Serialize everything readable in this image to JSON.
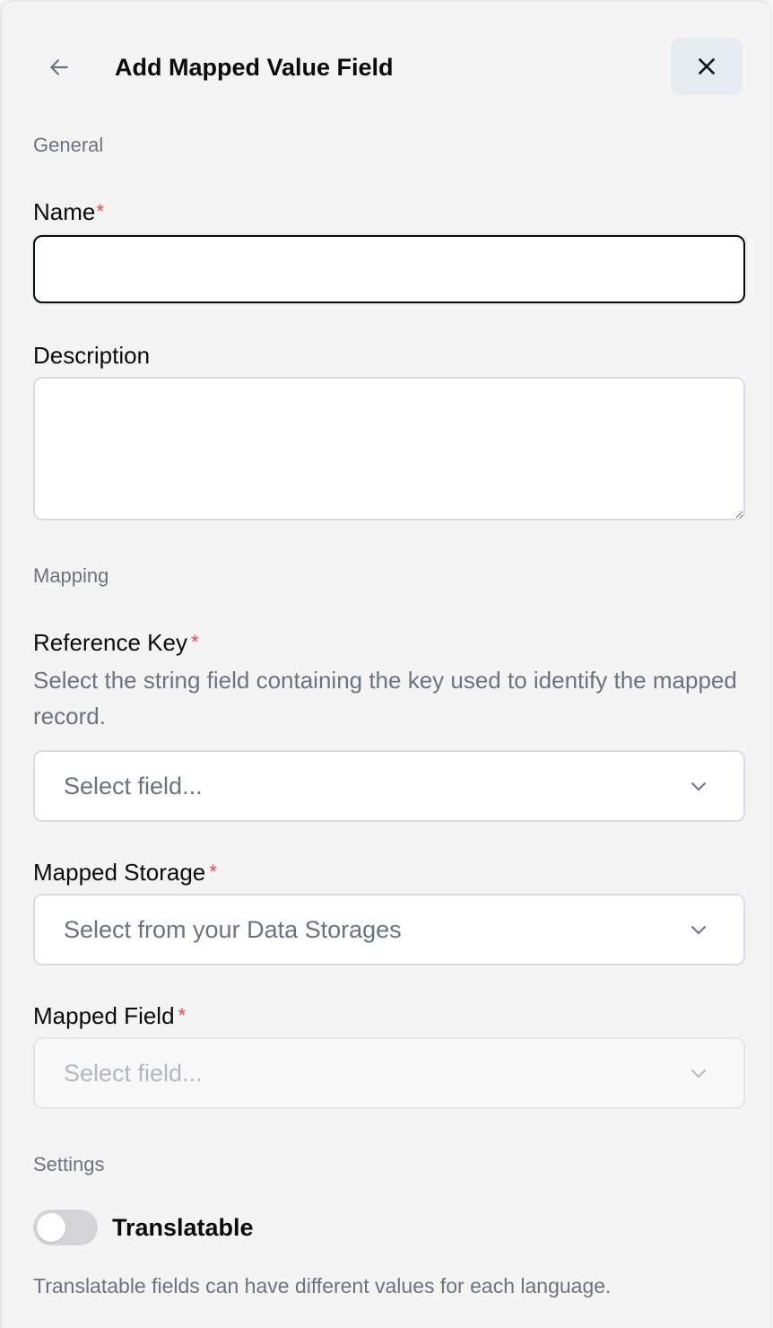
{
  "header": {
    "title": "Add Mapped Value Field"
  },
  "general": {
    "section_label": "General",
    "name": {
      "label": "Name",
      "required_mark": "*",
      "value": ""
    },
    "description": {
      "label": "Description",
      "value": ""
    }
  },
  "mapping": {
    "section_label": "Mapping",
    "reference_key": {
      "label": "Reference Key",
      "required_mark": "*",
      "help": "Select the string field containing the key used to identify the mapped record.",
      "placeholder": "Select field..."
    },
    "mapped_storage": {
      "label": "Mapped Storage",
      "required_mark": "*",
      "placeholder": "Select from your Data Storages"
    },
    "mapped_field": {
      "label": "Mapped Field",
      "required_mark": "*",
      "placeholder": "Select field...",
      "disabled": true
    }
  },
  "settings": {
    "section_label": "Settings",
    "translatable": {
      "label": "Translatable",
      "enabled": false,
      "help": "Translatable fields can have different values for each language."
    }
  },
  "icons": {
    "back": "arrow-left-icon",
    "close": "close-icon",
    "dropdown": "chevron-down-icon"
  },
  "colors": {
    "required": "#ef4444",
    "close_button_bg": "#e6ebf2",
    "muted_text": "#6b7280",
    "toggle_off": "#d4d4d8"
  }
}
